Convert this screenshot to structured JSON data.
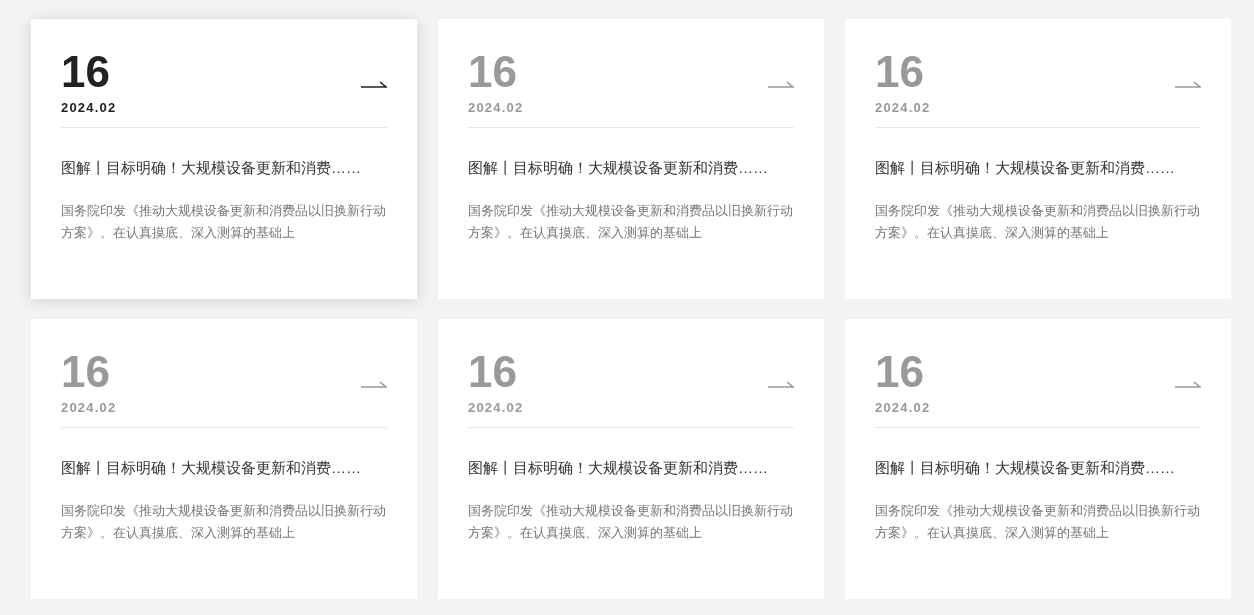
{
  "cards": [
    {
      "day": "16",
      "month": "2024.02",
      "title": "图解丨目标明确！大规模设备更新和消费……",
      "summary": "国务院印发《推动大规模设备更新和消费品以旧换新行动方案》。在认真摸底、深入测算的基础上",
      "selected": true
    },
    {
      "day": "16",
      "month": "2024.02",
      "title": "图解丨目标明确！大规模设备更新和消费……",
      "summary": "国务院印发《推动大规模设备更新和消费品以旧换新行动方案》。在认真摸底、深入测算的基础上",
      "selected": false
    },
    {
      "day": "16",
      "month": "2024.02",
      "title": "图解丨目标明确！大规模设备更新和消费……",
      "summary": "国务院印发《推动大规模设备更新和消费品以旧换新行动方案》。在认真摸底、深入测算的基础上",
      "selected": false
    },
    {
      "day": "16",
      "month": "2024.02",
      "title": "图解丨目标明确！大规模设备更新和消费……",
      "summary": "国务院印发《推动大规模设备更新和消费品以旧换新行动方案》。在认真摸底、深入测算的基础上",
      "selected": false
    },
    {
      "day": "16",
      "month": "2024.02",
      "title": "图解丨目标明确！大规模设备更新和消费……",
      "summary": "国务院印发《推动大规模设备更新和消费品以旧换新行动方案》。在认真摸底、深入测算的基础上",
      "selected": false
    },
    {
      "day": "16",
      "month": "2024.02",
      "title": "图解丨目标明确！大规模设备更新和消费……",
      "summary": "国务院印发《推动大规模设备更新和消费品以旧换新行动方案》。在认真摸底、深入测算的基础上",
      "selected": false
    }
  ]
}
